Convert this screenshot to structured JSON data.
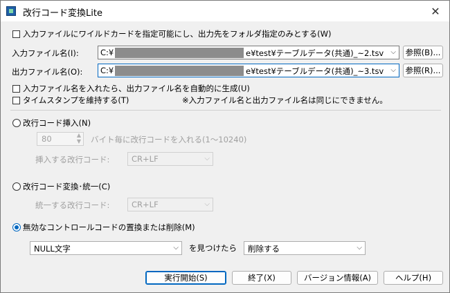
{
  "window": {
    "title": "改行コード変換Lite",
    "close_label": "✕"
  },
  "options": {
    "wildcard": "入力ファイルにワイルドカードを指定可能にし、出力先をフォルダ指定のみとする(W)",
    "auto_output": "入力ファイル名を入れたら、出力ファイル名を自動的に生成(U)",
    "timestamp": "タイムスタンプを維持する(T)",
    "note": "※入力ファイル名と出力ファイル名は同じにできません。"
  },
  "input": {
    "label": "入力ファイル名(I):",
    "prefix": "C:¥",
    "suffix": "e¥test¥テーブルデータ(共通)_~2.tsv",
    "browse": "参照(B)..."
  },
  "output": {
    "label": "出力ファイル名(O):",
    "prefix": "C:¥",
    "suffix": "e¥test¥テーブルデータ(共通)_~3.tsv",
    "browse": "参照(R)..."
  },
  "insert": {
    "label": "改行コード挿入(N)",
    "value": "80",
    "desc": "バイト毎に改行コードを入れる(1～10240)",
    "code_label": "挿入する改行コード:",
    "code_value": "CR+LF"
  },
  "unify": {
    "label": "改行コード変換･統一(C)",
    "code_label": "統一する改行コード:",
    "code_value": "CR+LF"
  },
  "control": {
    "label": "無効なコントロールコードの置換または削除(M)",
    "code_value": "NULL文字",
    "middle": "を見つけたら",
    "action_value": "削除する"
  },
  "buttons": {
    "run": "実行開始(S)",
    "exit": "終了(X)",
    "version": "バージョン情報(A)",
    "help": "ヘルプ(H)"
  }
}
